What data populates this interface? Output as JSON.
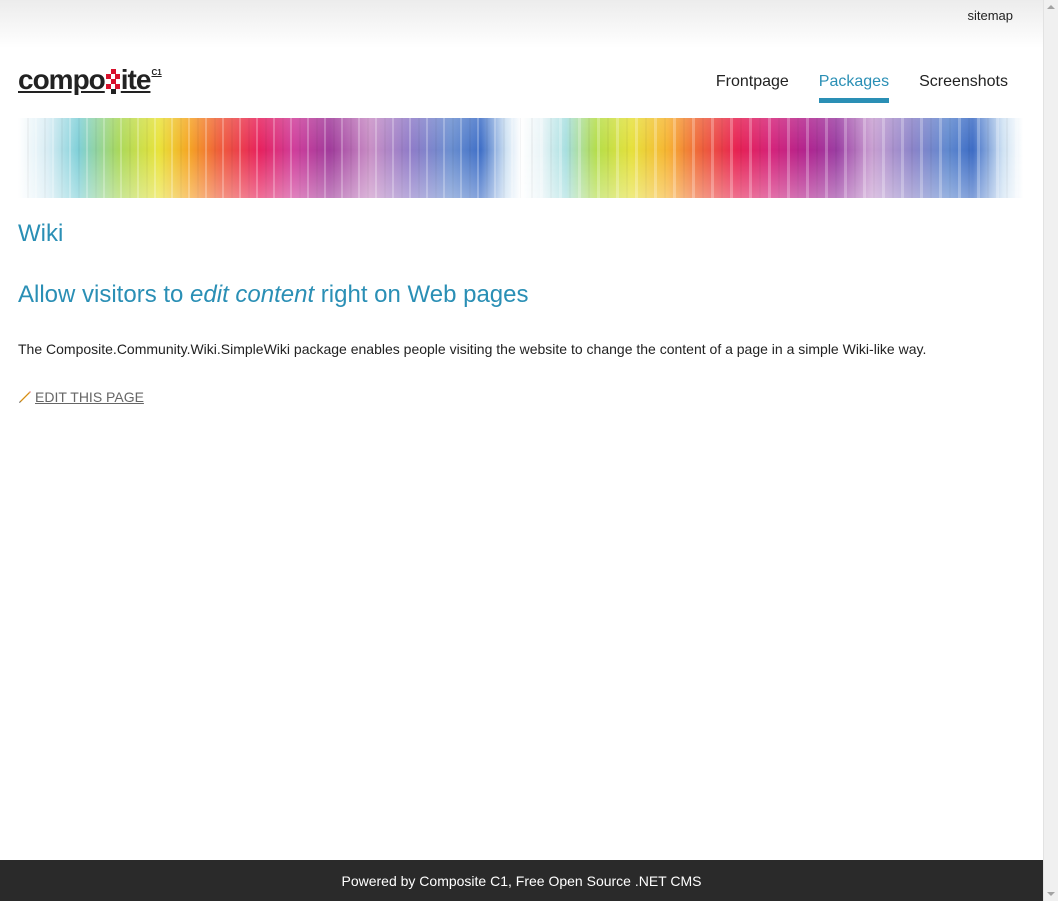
{
  "header": {
    "sitemap_label": "sitemap",
    "logo": {
      "text_before": "compo",
      "text_after": "ite",
      "superscript": "C1"
    }
  },
  "nav": {
    "items": [
      {
        "label": "Frontpage",
        "active": false
      },
      {
        "label": "Packages",
        "active": true
      },
      {
        "label": "Screenshots",
        "active": false
      }
    ]
  },
  "content": {
    "page_title": "Wiki",
    "subheading_before": "Allow visitors to ",
    "subheading_emphasis": "edit content",
    "subheading_after": " right on Web pages",
    "body_text": "The Composite.Community.Wiki.SimpleWiki package enables people visiting the website to change the content of a page in a simple Wiki-like way.",
    "edit_link_label": "EDIT THIS PAGE",
    "edit_icon": "pencil-icon"
  },
  "footer": {
    "text": "Powered by Composite C1, Free Open Source .NET CMS"
  },
  "colors": {
    "accent": "#2a8fb5",
    "logo_mark": "#d8112c",
    "footer_bg": "#2a2a2a"
  }
}
